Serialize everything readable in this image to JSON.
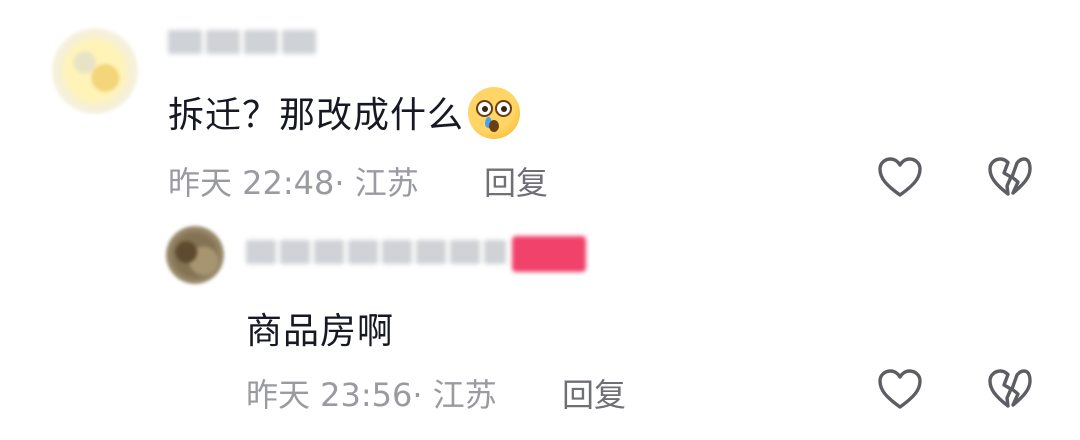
{
  "comment": {
    "text": "拆迁？那改成什么",
    "emoji": "flushed-crying-emoji",
    "time": "昨天 22:48",
    "location_separator": "· ",
    "location": "江苏",
    "reply_label": "回复"
  },
  "reply": {
    "text": "商品房啊",
    "time": "昨天 23:56",
    "location_separator": "· ",
    "location": "江苏",
    "reply_label": "回复"
  },
  "icons": {
    "like": "heart-outline-icon",
    "dislike": "broken-heart-icon"
  },
  "colors": {
    "text_primary": "#161823",
    "text_secondary": "#9a9ba0",
    "reply_text": "#6f7076",
    "badge": "#f0426a"
  }
}
